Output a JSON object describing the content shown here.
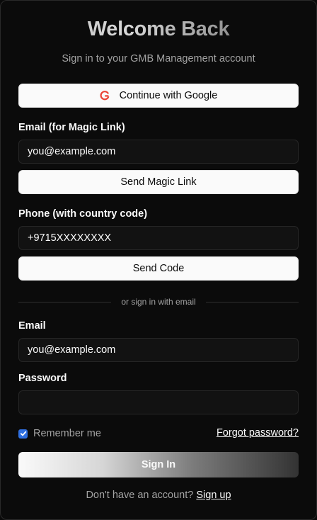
{
  "header": {
    "title": "Welcome Back",
    "subtitle": "Sign in to your GMB Management account"
  },
  "google": {
    "label": "Continue with Google",
    "icon": "google-icon"
  },
  "magic_link": {
    "label": "Email (for Magic Link)",
    "value": "you@example.com",
    "button": "Send Magic Link"
  },
  "phone": {
    "label": "Phone (with country code)",
    "value": "+9715XXXXXXXX",
    "button": "Send Code"
  },
  "divider": {
    "text": "or sign in with email"
  },
  "email_login": {
    "email_label": "Email",
    "email_value": "you@example.com",
    "password_label": "Password",
    "password_value": "",
    "remember_label": "Remember me",
    "remember_checked": true,
    "forgot_label": "Forgot password?",
    "submit": "Sign In"
  },
  "footer": {
    "prompt": "Don't have an account?",
    "link": "Sign up"
  },
  "colors": {
    "background": "#0a0a0a",
    "checkbox_accent": "#2f6fe0",
    "google_red": "#ea4335"
  }
}
